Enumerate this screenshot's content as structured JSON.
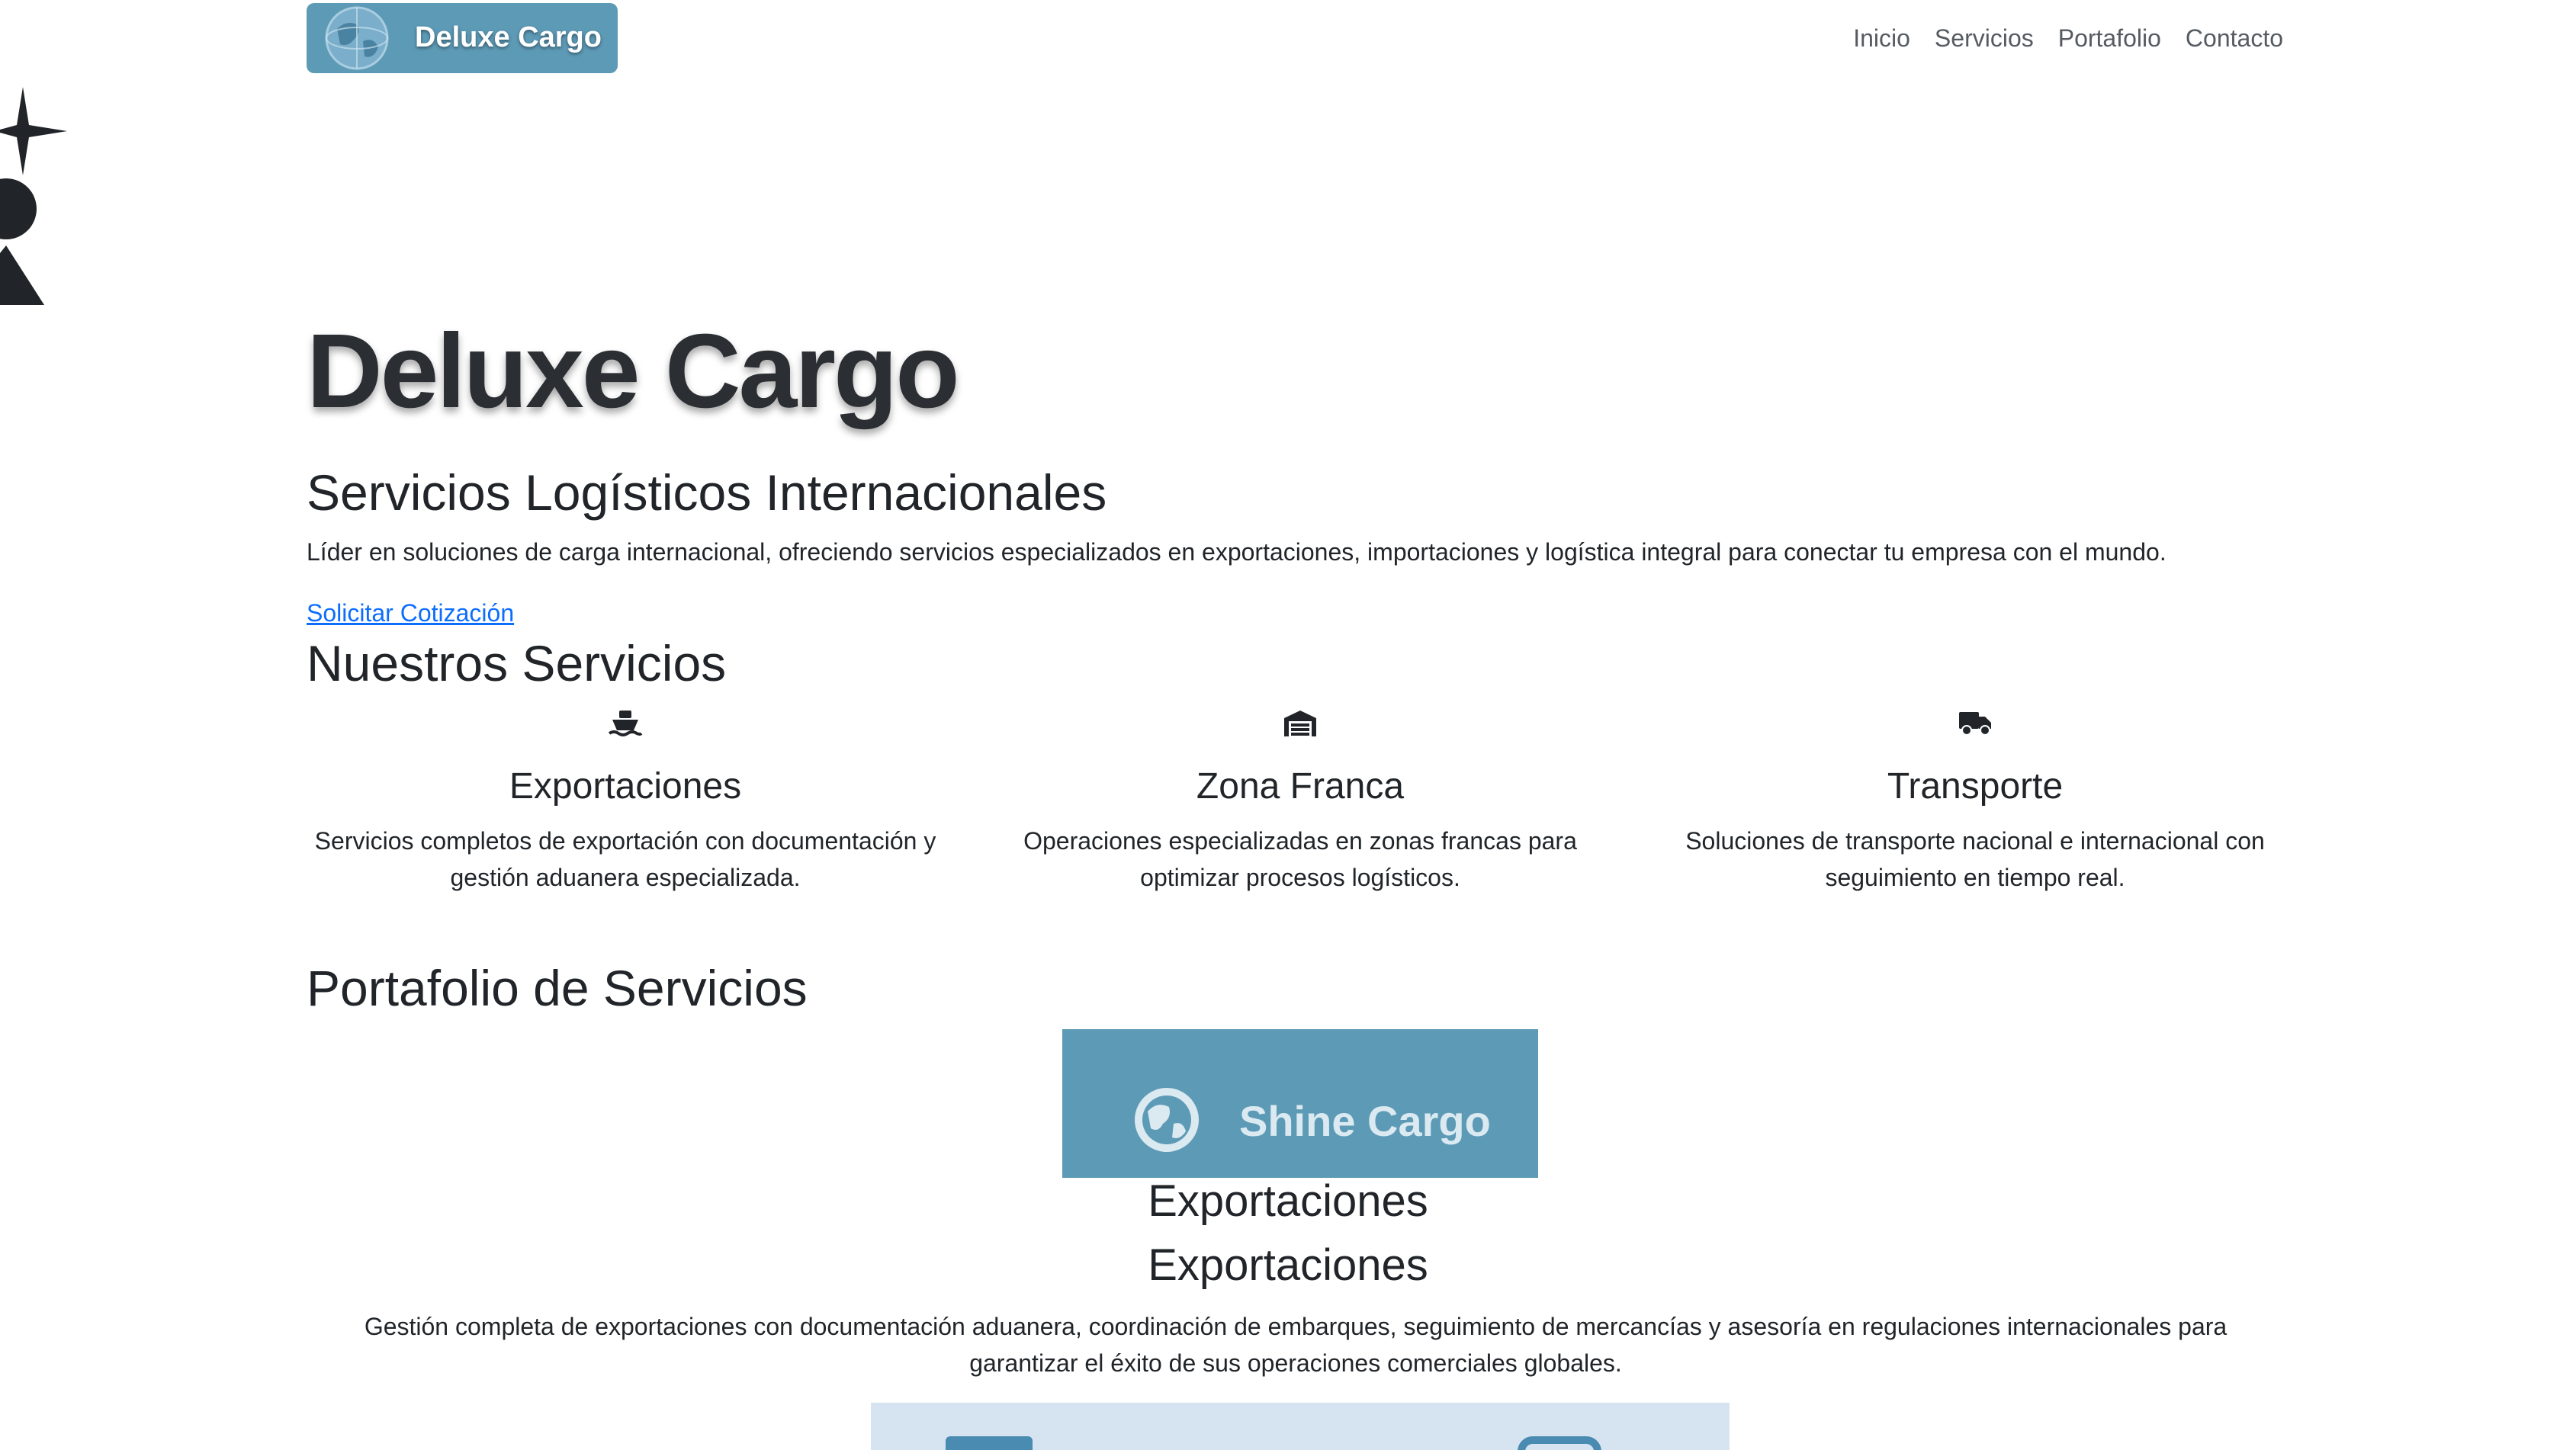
{
  "navbar": {
    "brand": "Deluxe Cargo",
    "links": [
      "Inicio",
      "Servicios",
      "Portafolio",
      "Contacto"
    ]
  },
  "hero": {
    "title": "Deluxe Cargo",
    "subtitle": "Servicios Logísticos Internacionales",
    "text": "Líder en soluciones de carga internacional, ofreciendo servicios especializados en exportaciones, importaciones y logística integral para conectar tu empresa con el mundo.",
    "cta": "Solicitar Cotización"
  },
  "services": {
    "title": "Nuestros Servicios",
    "items": [
      {
        "icon": "ship-icon",
        "title": "Exportaciones",
        "text": "Servicios completos de exportación con documentación y gestión aduanera especializada."
      },
      {
        "icon": "warehouse-icon",
        "title": "Zona Franca",
        "text": "Operaciones especializadas en zonas francas para optimizar procesos logísticos."
      },
      {
        "icon": "truck-icon",
        "title": "Transporte",
        "text": "Soluciones de transporte nacional e internacional con seguimiento en tiempo real."
      }
    ]
  },
  "portfolio": {
    "title": "Portafolio de Servicios",
    "image_text": "Shine Cargo",
    "heading_1": "Exportaciones",
    "heading_2": "Exportaciones",
    "description": "Gestión completa de exportaciones con documentación aduanera, coordinación de embarques, seguimiento de mercancías y asesoría en regulaciones internacionales para garantizar el éxito de sus operaciones comerciales globales."
  },
  "colors": {
    "brand": "#5d9ab6",
    "link": "#0d6efd",
    "text": "#212529"
  }
}
